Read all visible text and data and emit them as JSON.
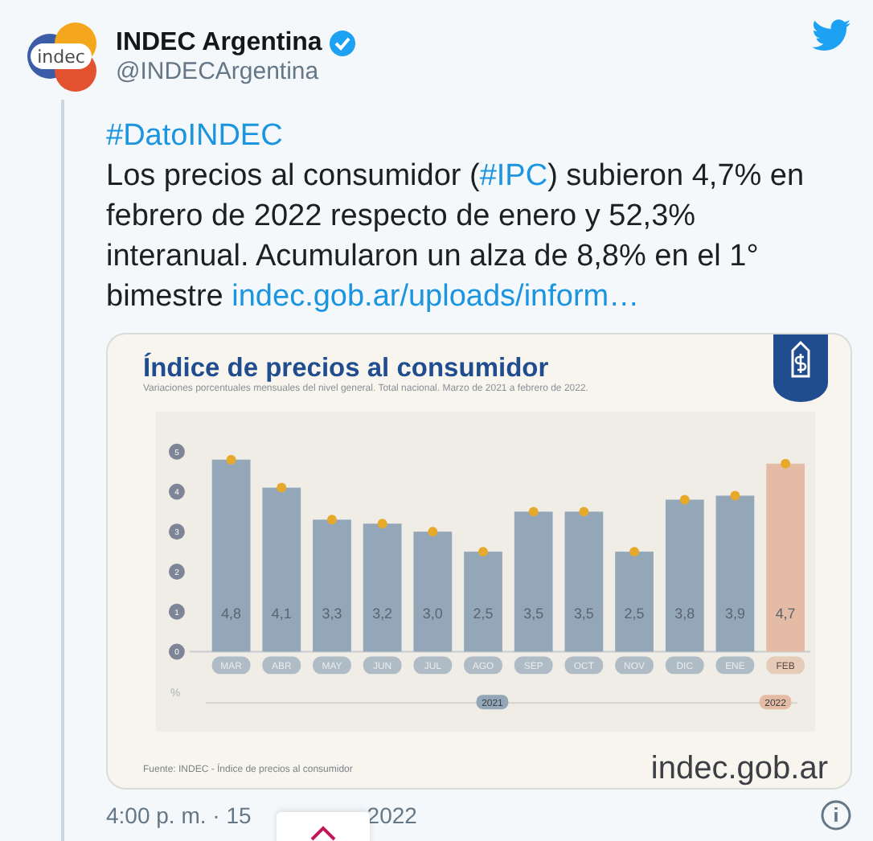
{
  "author": {
    "avatar_text": "indec",
    "name": "INDEC Argentina",
    "verified": true,
    "handle": "@INDECArgentina"
  },
  "tweet": {
    "hashtag_line": "#DatoINDEC",
    "text_parts": [
      {
        "kind": "text",
        "text": "Los precios al consumidor ("
      },
      {
        "kind": "link",
        "text": "#IPC"
      },
      {
        "kind": "text",
        "text": ") subieron 4,7% en febrero de 2022 respecto de enero y 52,3% interanual. Acumularon un alza de 8,8% en el 1° bimestre "
      },
      {
        "kind": "link",
        "text": "indec.gob.ar/uploads/inform…"
      }
    ]
  },
  "media": {
    "subtitle": "Variaciones porcentuales mensuales del nivel general. Total nacional. Marzo de 2021 a febrero de 2022.",
    "y_unit": "%",
    "source": "Fuente: INDEC - Índice de precios al consumidor",
    "logo_text": "indec.gob.ar",
    "chart_data": {
      "type": "bar",
      "title": "Índice de precios al consumidor",
      "categories": [
        "MAR",
        "ABR",
        "MAY",
        "JUN",
        "JUL",
        "AGO",
        "SEP",
        "OCT",
        "NOV",
        "DIC",
        "ENE",
        "FEB"
      ],
      "yticks": [
        0,
        1,
        2,
        3,
        4,
        5
      ],
      "ylim": [
        0,
        5
      ],
      "value_labels": [
        "4,8",
        "4,1",
        "3,3",
        "3,2",
        "3,0",
        "2,5",
        "3,5",
        "3,5",
        "2,5",
        "3,8",
        "3,9",
        "4,7"
      ],
      "series": [
        {
          "name": "2021",
          "color": "#94a7b8",
          "values": [
            4.8,
            4.1,
            3.3,
            3.2,
            3.0,
            2.5,
            3.5,
            3.5,
            2.5,
            3.8,
            3.9,
            null
          ]
        },
        {
          "name": "2022",
          "color": "#e4bca5",
          "values": [
            null,
            null,
            null,
            null,
            null,
            null,
            null,
            null,
            null,
            null,
            null,
            4.7
          ]
        }
      ]
    }
  },
  "footer": {
    "time": "4:00 p. m. · 15",
    "year": "2022"
  }
}
